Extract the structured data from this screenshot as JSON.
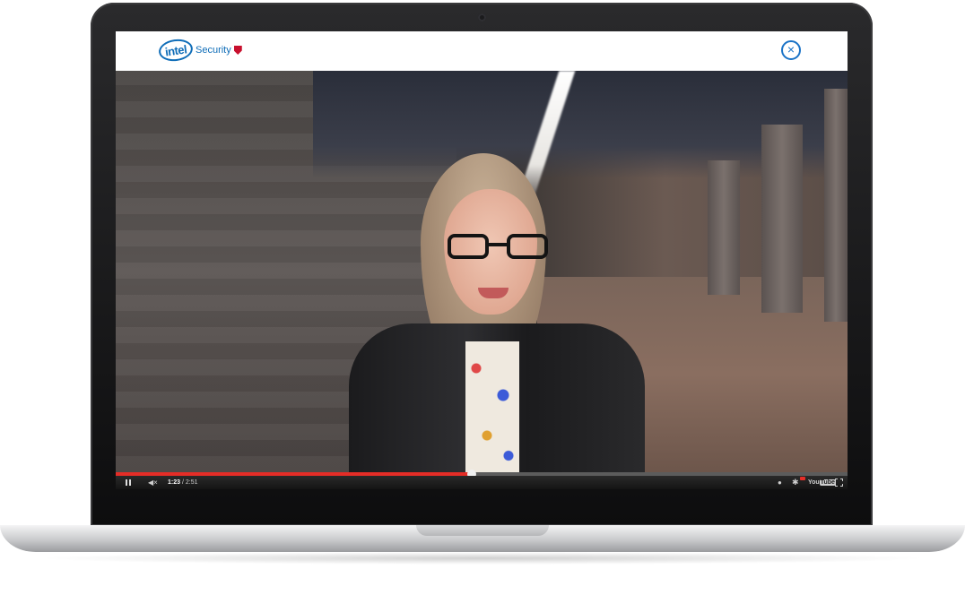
{
  "header": {
    "logo_mark": "intel",
    "logo_text": "Security",
    "close_glyph": "×"
  },
  "player": {
    "current_time": "1:23",
    "separator": " / ",
    "duration": "2:51",
    "progress_fraction": 0.486,
    "volume_glyph": "◀×",
    "info_glyph": "●",
    "settings_glyph": "✱",
    "youtube_you": "You",
    "youtube_tube": "Tube",
    "accent_color": "#e52d27"
  },
  "icons": {
    "close": "close-icon",
    "pause": "pause-icon",
    "volume": "mute-icon",
    "info": "info-icon",
    "settings": "gear-icon",
    "fullscreen": "fullscreen-icon"
  }
}
